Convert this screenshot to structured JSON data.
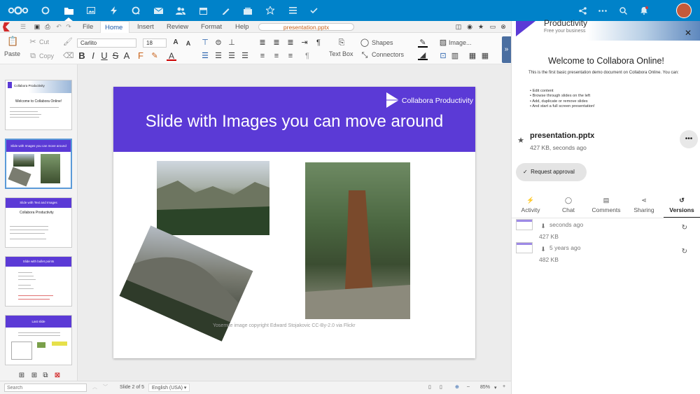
{
  "nav": {
    "items": [
      "nextcloud-logo",
      "dashboard-icon",
      "files-icon",
      "photos-icon",
      "activity-icon",
      "talk-icon",
      "mail-icon",
      "contacts-icon",
      "calendar-icon",
      "notes-icon",
      "deck-icon",
      "favorites-icon",
      "tasks-icon",
      "checkmark-icon"
    ],
    "right": [
      "share-icon",
      "more-icon",
      "search-icon",
      "notifications-icon",
      "avatar"
    ]
  },
  "menu": {
    "tabs": [
      "File",
      "Home",
      "Insert",
      "Review",
      "Format",
      "Help"
    ],
    "active": "Home",
    "filename": "presentation.pptx"
  },
  "toolbar": {
    "paste": "Paste",
    "cut": "Cut",
    "copy": "Copy",
    "font": "Carlito",
    "font_size": "18",
    "text_box": "Text Box",
    "shapes": "Shapes",
    "connectors": "Connectors",
    "image": "Image..."
  },
  "slides": {
    "thumbs": [
      {
        "title": "Welcome to Collabora Online!",
        "header": "Collabora Productivity"
      },
      {
        "title": "Slide with Images you can move around"
      },
      {
        "title": "Slide with Text and Images",
        "header": "Collabora Productivity"
      },
      {
        "title": "Slide with bullet points"
      },
      {
        "title": "Last slide"
      }
    ],
    "selected": 1
  },
  "slide": {
    "title": "Slide with Images you can move around",
    "brand": "Collabora Productivity",
    "credit": "Yosemite image copyright Edward Stojakovic CC-By-2.0 via Flickr"
  },
  "sidebar": {
    "header_title": "Productivity",
    "header_sub": "Free your business",
    "welcome": "Welcome to Collabora Online!",
    "intro": "This is the first basic presentation demo document on Collabora Online. You can:",
    "bullets": [
      "Edit content",
      "Browse through slides on the left",
      "Add, duplicate or remove slides",
      "And start a full screen presentation!"
    ],
    "file_name": "presentation.pptx",
    "file_meta": "427 KB, seconds ago",
    "request_approval": "Request approval",
    "tabs": [
      {
        "label": "Activity",
        "icon": "activity-icon"
      },
      {
        "label": "Chat",
        "icon": "chat-icon"
      },
      {
        "label": "Comments",
        "icon": "comments-icon"
      },
      {
        "label": "Sharing",
        "icon": "share-icon"
      },
      {
        "label": "Versions",
        "icon": "versions-icon"
      }
    ],
    "active_tab": "Versions",
    "versions": [
      {
        "time": "seconds ago",
        "size": "427 KB"
      },
      {
        "time": "5 years ago",
        "size": "482 KB"
      }
    ]
  },
  "status": {
    "search_placeholder": "Search",
    "slide_info": "Slide 2 of 5",
    "language": "English (USA)",
    "zoom": "85%"
  }
}
